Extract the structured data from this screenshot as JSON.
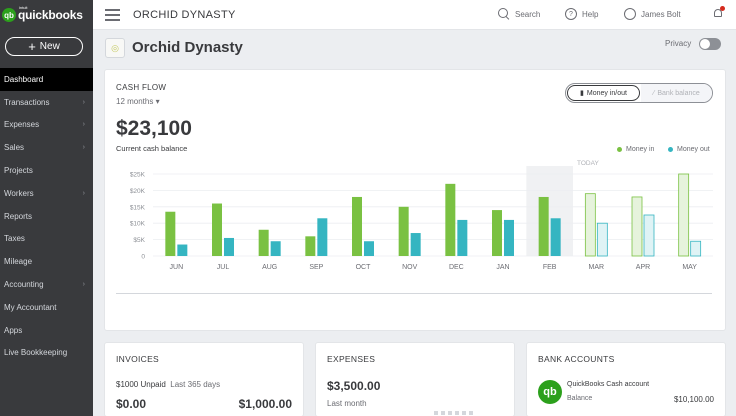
{
  "brand": {
    "intuit": "intuit",
    "name": "quickbooks",
    "mark": "qb"
  },
  "new_button": {
    "label": "New",
    "plus": "+"
  },
  "nav": [
    {
      "label": "Dashboard",
      "chevron": ""
    },
    {
      "label": "Transactions",
      "chevron": "›"
    },
    {
      "label": "Expenses",
      "chevron": "›"
    },
    {
      "label": "Sales",
      "chevron": "›"
    },
    {
      "label": "Projects",
      "chevron": ""
    },
    {
      "label": "Workers",
      "chevron": "›"
    },
    {
      "label": "Reports",
      "chevron": ""
    },
    {
      "label": "Taxes",
      "chevron": ""
    },
    {
      "label": "Mileage",
      "chevron": ""
    },
    {
      "label": "Accounting",
      "chevron": "›"
    },
    {
      "label": "My Accountant",
      "chevron": ""
    },
    {
      "label": "Apps",
      "chevron": ""
    },
    {
      "label": "Live Bookkeeping",
      "chevron": ""
    }
  ],
  "topbar": {
    "company": "ORCHID DYNASTY",
    "search": "Search",
    "help": "Help",
    "help_glyph": "?",
    "user": "James Bolt"
  },
  "header": {
    "title": "Orchid Dynasty",
    "privacy": "Privacy"
  },
  "cashflow": {
    "label": "CASH FLOW",
    "period": "12 months ▾",
    "amount": "$23,100",
    "sub": "Current cash balance",
    "toggle_on": "Money in/out",
    "toggle_off": "Bank balance",
    "legend_in": "Money in",
    "legend_out": "Money out"
  },
  "colors": {
    "money_in": "#7ac142",
    "money_out": "#35b5c1",
    "brand": "#2ca01c"
  },
  "chart_data": {
    "type": "bar",
    "categories": [
      "JUN",
      "JUL",
      "AUG",
      "SEP",
      "OCT",
      "NOV",
      "DEC",
      "JAN",
      "FEB",
      "MAR",
      "APR",
      "MAY"
    ],
    "series": [
      {
        "name": "Money in",
        "values": [
          13500,
          16000,
          8000,
          6000,
          18000,
          15000,
          22000,
          14000,
          18000,
          19000,
          18000,
          25000
        ]
      },
      {
        "name": "Money out",
        "values": [
          3500,
          5500,
          4500,
          11500,
          4500,
          7000,
          11000,
          11000,
          11500,
          10000,
          12500,
          4500
        ]
      }
    ],
    "projected": [
      false,
      false,
      false,
      false,
      false,
      false,
      false,
      false,
      false,
      true,
      true,
      true
    ],
    "y_ticks": [
      "$25K",
      "$20K",
      "$15K",
      "$10K",
      "$5K",
      "0"
    ],
    "ylim": [
      0,
      25000
    ],
    "today_marker": "TODAY",
    "legend": "top-right",
    "grid": true
  },
  "invoices": {
    "title": "INVOICES",
    "unpaid": "$1000 Unpaid",
    "unpaid_range": "Last 365 days",
    "left_amount": "$0.00",
    "right_amount": "$1,000.00"
  },
  "expenses": {
    "title": "EXPENSES",
    "amount": "$3,500.00",
    "sub": "Last month"
  },
  "bank": {
    "title": "BANK ACCOUNTS",
    "account": "QuickBooks Cash account",
    "balance_label": "Balance",
    "balance": "$10,100.00"
  }
}
